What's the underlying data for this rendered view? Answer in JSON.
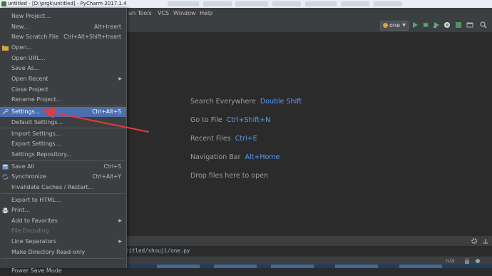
{
  "window": {
    "title": "untitled - [D:\\prgk\\untitled] - PyCharm 2017.1.4"
  },
  "menubar": {
    "items": [
      "un",
      "Tools",
      "VCS",
      "Window",
      "Help"
    ]
  },
  "toolbar": {
    "run_config": "one",
    "icons": [
      "run-icon",
      "debug-icon",
      "coverage-icon",
      "profile-icon",
      "stop-icon",
      "layout-icon",
      "search-icon"
    ]
  },
  "file_menu": {
    "items": [
      {
        "label": "New Project...",
        "shortcut": ""
      },
      {
        "label": "New...",
        "shortcut": "Alt+Insert"
      },
      {
        "label": "New Scratch File",
        "shortcut": "Ctrl+Alt+Shift+Insert"
      },
      {
        "label": "Open...",
        "shortcut": "",
        "icon": "folder-icon"
      },
      {
        "label": "Open URL...",
        "shortcut": ""
      },
      {
        "label": "Save As...",
        "shortcut": ""
      },
      {
        "label": "Open Recent",
        "shortcut": "",
        "submenu": true
      },
      {
        "label": "Close Project",
        "shortcut": ""
      },
      {
        "label": "Rename Project...",
        "shortcut": ""
      },
      {
        "label": "Settings...",
        "shortcut": "Ctrl+Alt+S",
        "icon": "wrench-icon",
        "selected": true
      },
      {
        "label": "Default Settings...",
        "shortcut": ""
      },
      {
        "label": "Import Settings...",
        "shortcut": ""
      },
      {
        "label": "Export Settings...",
        "shortcut": ""
      },
      {
        "label": "Settings Repository...",
        "shortcut": ""
      },
      {
        "label": "Save All",
        "shortcut": "Ctrl+S",
        "icon": "save-icon"
      },
      {
        "label": "Synchronize",
        "shortcut": "Ctrl+Alt+Y",
        "icon": "sync-icon"
      },
      {
        "label": "Invalidate Caches / Restart...",
        "shortcut": ""
      },
      {
        "label": "Export to HTML...",
        "shortcut": ""
      },
      {
        "label": "Print...",
        "shortcut": "",
        "icon": "print-icon"
      },
      {
        "label": "Add to Favorites",
        "shortcut": "",
        "submenu": true
      },
      {
        "label": "File Encoding",
        "shortcut": "",
        "disabled": true
      },
      {
        "label": "Line Separators",
        "shortcut": "",
        "submenu": true
      },
      {
        "label": "Make Directory Read-only",
        "shortcut": ""
      },
      {
        "label": "Power Save Mode",
        "shortcut": ""
      }
    ]
  },
  "editor": {
    "hints": [
      {
        "text": "Search Everywhere",
        "key": "Double Shift"
      },
      {
        "text": "Go to File",
        "key": "Ctrl+Shift+N"
      },
      {
        "text": "Recent Files",
        "key": "Ctrl+E"
      },
      {
        "text": "Navigation Bar",
        "key": "Alt+Home"
      },
      {
        "text": "Drop files here to open",
        "key": ""
      }
    ]
  },
  "bottom": {
    "path": "titled/shouji/one.py"
  },
  "status": {
    "na": "n/a"
  },
  "colors": {
    "selection": "#4b6eaf",
    "arrow": "#e8393c",
    "hint_key": "#589df6"
  }
}
